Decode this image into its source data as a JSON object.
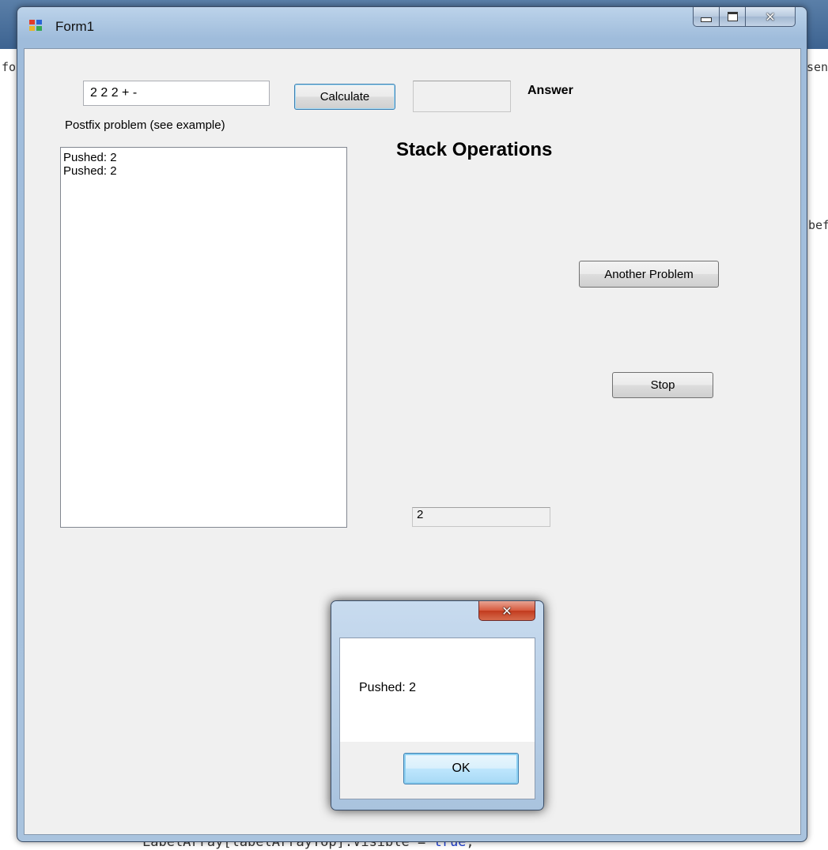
{
  "window": {
    "title": "Form1"
  },
  "form": {
    "postfix_input_value": "2 2 2 + -",
    "postfix_label": "Postfix problem (see example)",
    "calculate_label": "Calculate",
    "answer_value": "",
    "answer_label": "Answer",
    "stack_heading": "Stack Operations",
    "another_problem_label": "Another Problem",
    "stop_label": "Stop",
    "stack_top_value": "2",
    "log_items": [
      "Pushed: 2",
      "Pushed: 2"
    ]
  },
  "dialog": {
    "message": "Pushed: 2",
    "ok_label": "OK"
  },
  "background": {
    "left_edge_text": "fo",
    "right_edge_top": "send",
    "right_edge_mid": "bef",
    "bottom_code_prefix": "LabelArray[labelArrayTop].Visible = ",
    "bottom_code_keyword": "true",
    "bottom_code_suffix": ";"
  }
}
